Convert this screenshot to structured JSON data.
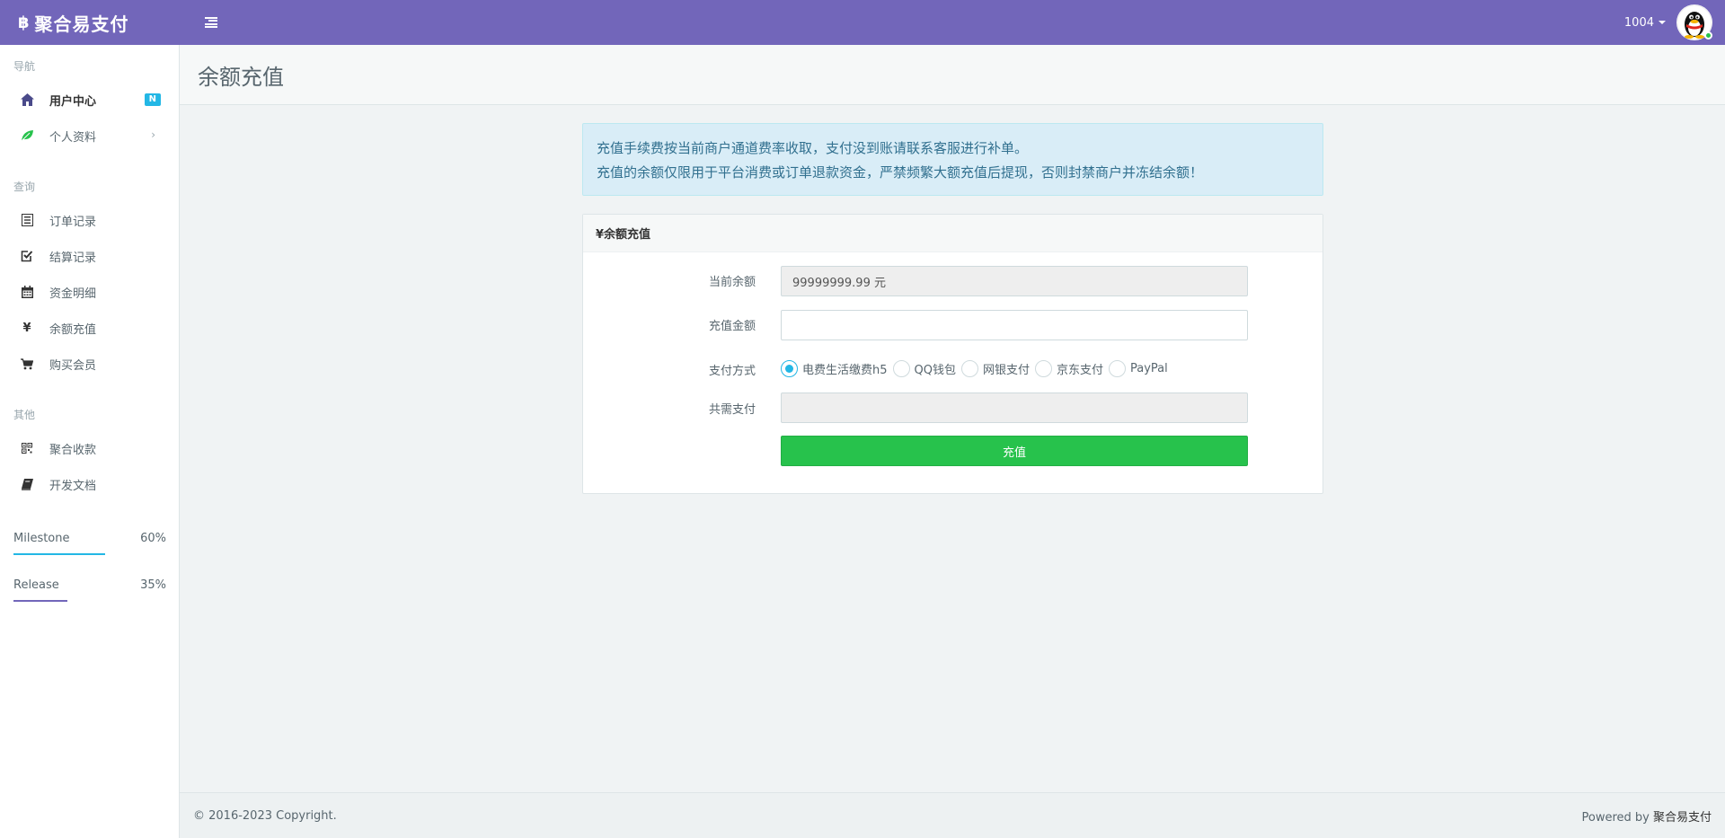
{
  "header": {
    "brand_icon": "฿",
    "brand_name": "聚合易支付",
    "menu_toggle_icon": "menu-indent-icon",
    "user": "1004",
    "avatar_icon": "qq-penguin-icon",
    "bg_color": "#7266ba"
  },
  "sidebar": {
    "sections": [
      {
        "heading": "导航"
      },
      {
        "heading": "查询"
      },
      {
        "heading": "其他"
      }
    ],
    "items": [
      {
        "label": "用户中心",
        "icon": "home-icon",
        "badge": "N",
        "active": true
      },
      {
        "label": "个人资料",
        "icon": "leaf-icon",
        "chevron": "›"
      },
      {
        "label": "订单记录",
        "icon": "list-icon"
      },
      {
        "label": "结算记录",
        "icon": "check-square-icon"
      },
      {
        "label": "资金明细",
        "icon": "calendar-icon"
      },
      {
        "label": "余额充值",
        "icon": "yen-icon"
      },
      {
        "label": "购买会员",
        "icon": "cart-icon"
      },
      {
        "label": "聚合收款",
        "icon": "qrcode-icon"
      },
      {
        "label": "开发文档",
        "icon": "book-icon"
      }
    ],
    "progress": [
      {
        "label": "Milestone",
        "value": "60%",
        "fraction": 0.6,
        "color": "#23b7e5"
      },
      {
        "label": "Release",
        "value": "35%",
        "fraction": 0.35,
        "color": "#7266ba"
      }
    ]
  },
  "page": {
    "title": "余额充值"
  },
  "alert": {
    "line1": "充值手续费按当前商户通道费率收取，支付没到账请联系客服进行补单。",
    "line2": "充值的余额仅限用于平台消费或订单退款资金，严禁频繁大额充值后提现，否则封禁商户并冻结余额！"
  },
  "panel": {
    "heading": "¥余额充值",
    "balance_label": "当前余额",
    "balance_value": "99999999.99 元",
    "amount_label": "充值金额",
    "amount_value": "",
    "pay_method_label": "支付方式",
    "pay_methods": [
      "电费生活缴费h5",
      "QQ钱包",
      "网银支付",
      "京东支付",
      "PayPal"
    ],
    "selected_method": 0,
    "total_label": "共需支付",
    "total_value": "",
    "submit_label": "充值"
  },
  "footer": {
    "copyright": "© 2016-2023 Copyright.",
    "powered_by": "Powered by",
    "powered_name": "聚合易支付"
  }
}
